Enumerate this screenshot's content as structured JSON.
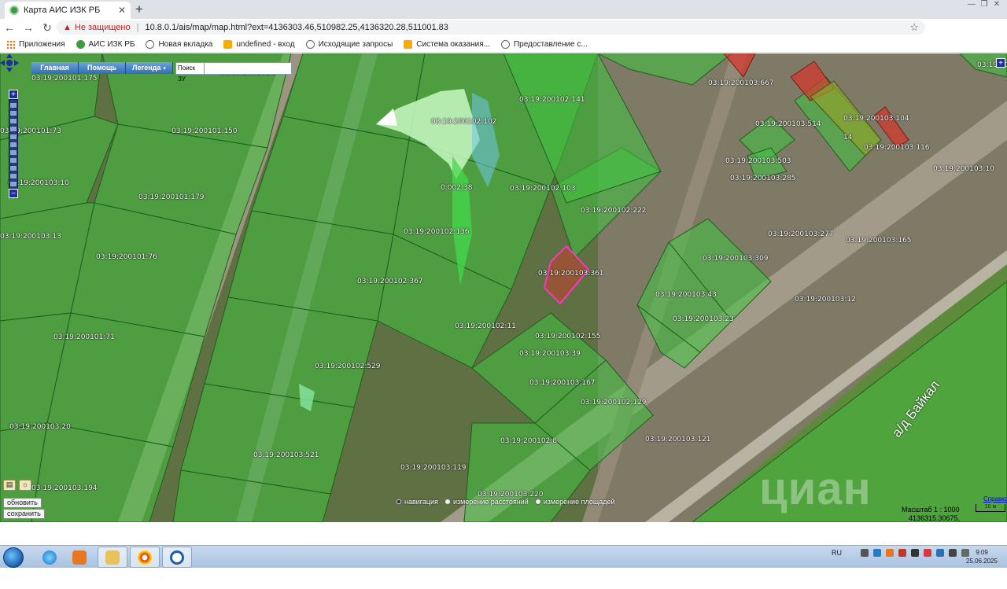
{
  "browser": {
    "tab_title": "Карта АИС ИЗК РБ",
    "not_secure": "Не защищено",
    "url": "10.8.0.1/ais/map/map.html?ext=4136303.46,510982.25,4136320.28,511001.83",
    "bookmarks": [
      {
        "label": "Приложения",
        "icon": "grid"
      },
      {
        "label": "АИС ИЗК РБ",
        "icon": "leaf"
      },
      {
        "label": "Новая вкладка",
        "icon": "globe"
      },
      {
        "label": "undefined - вход",
        "icon": "yellow"
      },
      {
        "label": "Исходящие запросы",
        "icon": "globe"
      },
      {
        "label": "Система оказания...",
        "icon": "yellow"
      },
      {
        "label": "Предоставление с...",
        "icon": "globe"
      }
    ]
  },
  "map": {
    "menu": [
      {
        "label": "Главная"
      },
      {
        "label": "Помощь"
      },
      {
        "label": "Легенда",
        "caret": "▾"
      }
    ],
    "search_label": "Поиск ЗУ",
    "search_value": "",
    "road_label": "а/д Байкал",
    "buttons": {
      "refresh": "обновить",
      "save": "сохранить"
    },
    "modes": [
      {
        "label": "навигация",
        "selected": true
      },
      {
        "label": "измерение расстояний",
        "selected": false
      },
      {
        "label": "измерение площадей",
        "selected": false
      }
    ],
    "scale": "Масштаб 1 : 1000",
    "coords": "4136315.30675, 510981.18015",
    "scale_link": "Справка",
    "scale_bar": "10 м",
    "watermark": "циан",
    "parcel_labels": [
      {
        "text": "03:19:200101:175"
      },
      {
        "text": "03:19:200101:5"
      },
      {
        "text": "03:19:200102:102"
      },
      {
        "text": "03:19:200102:141"
      },
      {
        "text": "03:19:200102:"
      },
      {
        "text": "03:19:200101:73"
      },
      {
        "text": "03:19:200101:150"
      },
      {
        "text": "03:19:200101:179"
      },
      {
        "text": "03:19:200101:76"
      },
      {
        "text": "03:19:200101:71"
      },
      {
        "text": "03:19:200103:20"
      },
      {
        "text": "03:19:200103:194"
      },
      {
        "text": "0:002:38"
      },
      {
        "text": "03:19:200102:136"
      },
      {
        "text": "03:19:200102:103"
      },
      {
        "text": "03:19:200102:222"
      },
      {
        "text": "03:19:200102:367"
      },
      {
        "text": "03:19:200103:361"
      },
      {
        "text": "03:19:200102:11"
      },
      {
        "text": "03:19:200102:155"
      },
      {
        "text": "03:19:200103:39"
      },
      {
        "text": "03:19:200103:167"
      },
      {
        "text": "03:19:200102:129"
      },
      {
        "text": "03:19:200102:529"
      },
      {
        "text": "03:19:200103:521"
      },
      {
        "text": "03:19:200103:119"
      },
      {
        "text": "03:19:200102:8"
      },
      {
        "text": "03:19:200103:220"
      },
      {
        "text": "03:19:200103:121"
      },
      {
        "text": "03:19:200103:667"
      },
      {
        "text": "03:19:200103:514"
      },
      {
        "text": "03:19:200103:104"
      },
      {
        "text": "03:19:200103:116"
      },
      {
        "text": "03:19:200103:503"
      },
      {
        "text": "03:19:200103:285"
      },
      {
        "text": "03:19:200103:10"
      },
      {
        "text": "03:19:200103:277"
      },
      {
        "text": "03:19:200103:165"
      },
      {
        "text": "03:19:200103:309"
      },
      {
        "text": "03:19:200103:43"
      },
      {
        "text": "03:19:200103:23"
      },
      {
        "text": "03:19:200103:12"
      },
      {
        "text": "03:19:200103:10"
      },
      {
        "text": "03:19:200103:13"
      },
      {
        "text": "14"
      }
    ]
  },
  "taskbar": {
    "lang": "RU",
    "time": "9:09",
    "date": "25.06.2025",
    "apps": [
      "windows-explorer",
      "internet-explorer",
      "media-player",
      "file-manager",
      "yandex-browser",
      "connect-app"
    ]
  },
  "colors": {
    "parcel_fill": "#3fc43f",
    "highlight_fill": "#ff66cc",
    "red_parcel": "#d9352b",
    "menu_blue": "#2e6fb4"
  }
}
